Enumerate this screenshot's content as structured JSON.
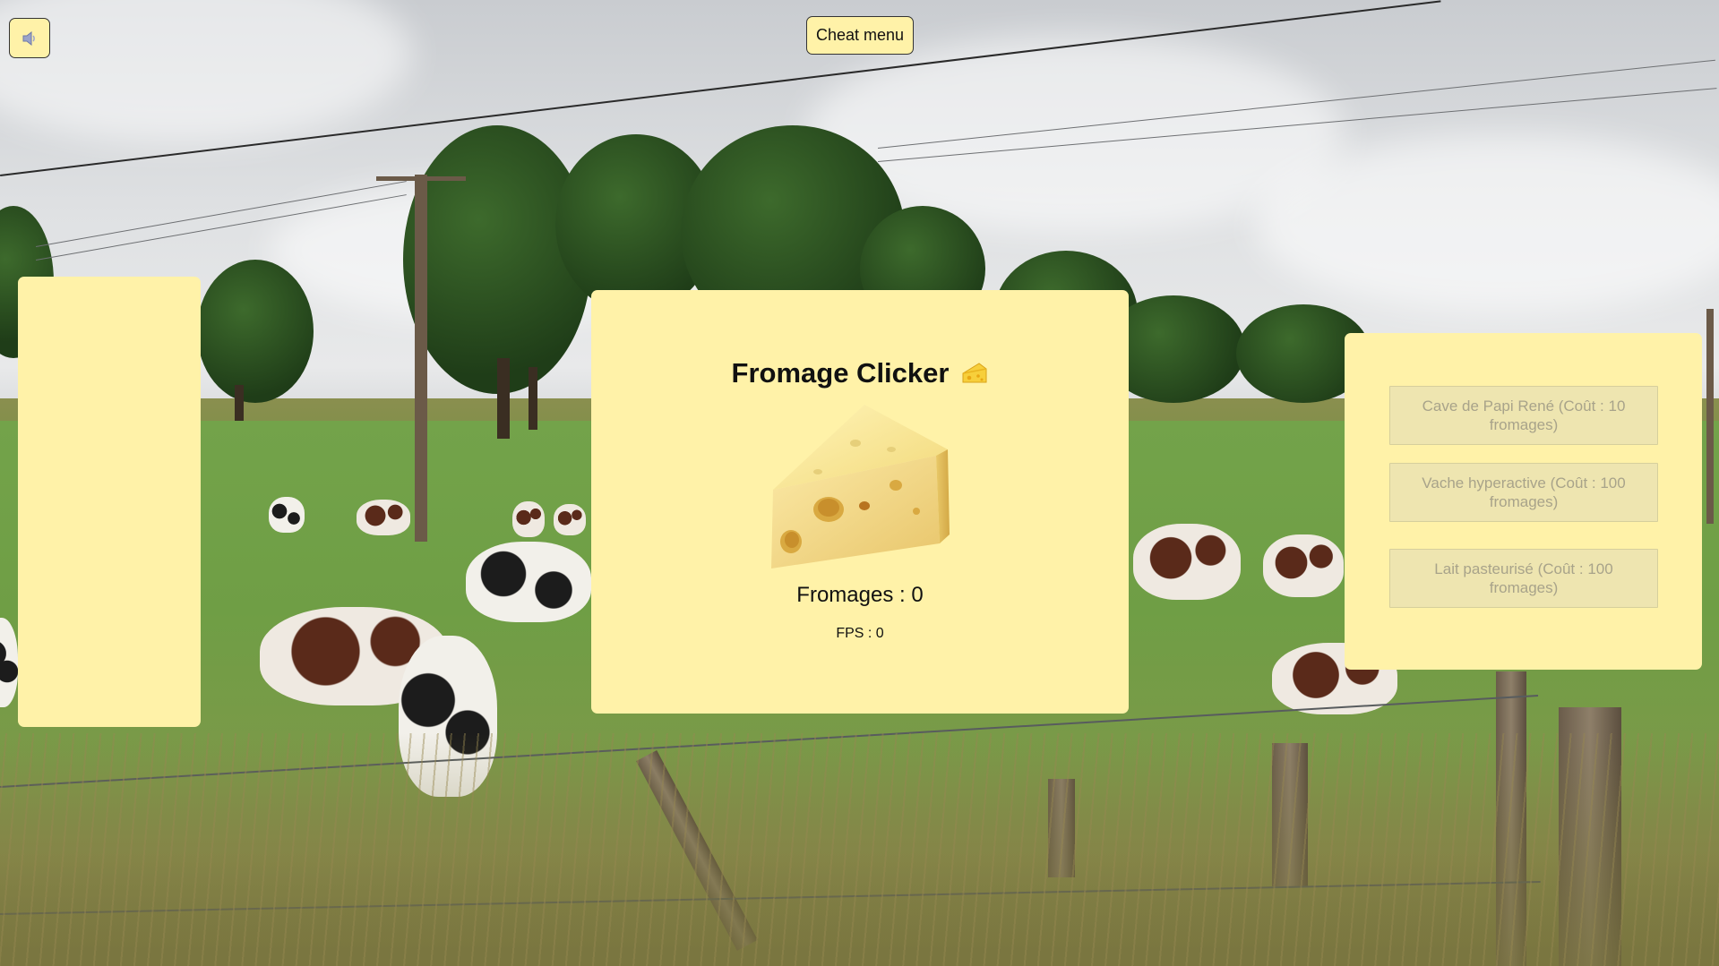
{
  "controls": {
    "sound_icon": "speaker-icon",
    "cheat_label": "Cheat menu"
  },
  "game": {
    "title": "Fromage Clicker",
    "title_icon": "cheese-emoji",
    "count_text": "Fromages : 0",
    "fps_text": "FPS : 0",
    "fromages": 0,
    "fps": 0
  },
  "shop": {
    "items": [
      {
        "label": "Cave de Papi René (Coût : 10 fromages)",
        "enabled": false
      },
      {
        "label": "Vache hyperactive (Coût : 100 fromages)",
        "enabled": false
      },
      {
        "label": "Lait pasteurisé (Coût : 100 fromages)",
        "enabled": false
      }
    ]
  },
  "colors": {
    "panel": "#fff2a8",
    "button_disabled_bg": "#eee5b0",
    "button_disabled_text": "#a8a38a"
  }
}
